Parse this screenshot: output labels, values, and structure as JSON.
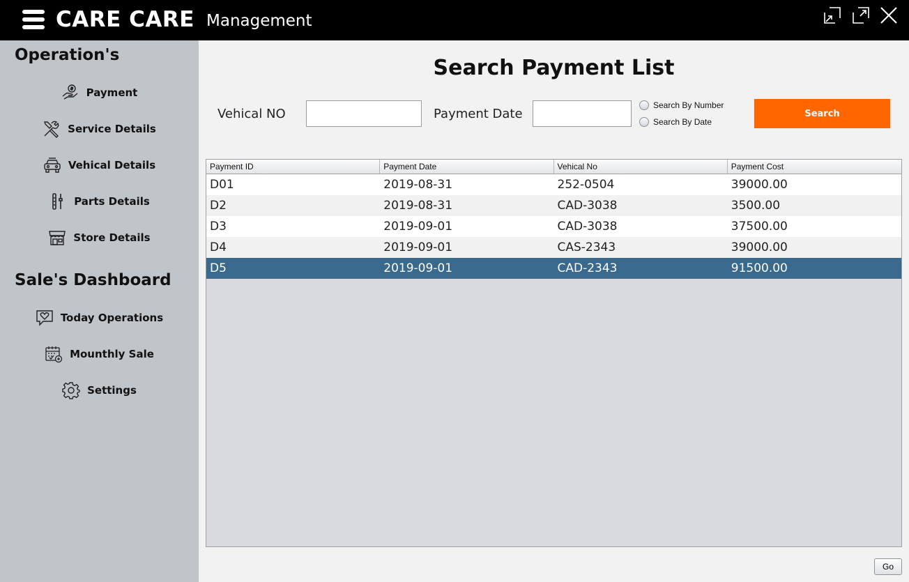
{
  "header": {
    "brand": "CARE CARE",
    "subtitle": "Management"
  },
  "sidebar": {
    "operations_title": "Operation's",
    "operations": [
      {
        "label": "Payment",
        "icon": "payment-hand-icon"
      },
      {
        "label": "Service Details",
        "icon": "tools-icon"
      },
      {
        "label": "Vehical Details",
        "icon": "car-icon"
      },
      {
        "label": "Parts Details",
        "icon": "parts-icon"
      },
      {
        "label": "Store Details",
        "icon": "store-icon"
      }
    ],
    "dashboard_title": "Sale's Dashboard",
    "dashboard": [
      {
        "label": "Today Operations",
        "icon": "chat-heart-icon"
      },
      {
        "label": "Mounthly Sale",
        "icon": "calendar-icon"
      },
      {
        "label": "Settings",
        "icon": "gear-icon"
      }
    ]
  },
  "main": {
    "title": "Search Payment List",
    "vehicle_label": "Vehical NO",
    "vehicle_value": "",
    "date_label": "Payment Date",
    "date_value": "",
    "radio_number": "Search By Number",
    "radio_date": "Search By Date",
    "search_button": "Search",
    "go_button": "Go",
    "accent_color": "#ff6600",
    "selected_row_color": "#39698c"
  },
  "table": {
    "columns": [
      "Payment ID",
      "Payment Date",
      "Vehical No",
      "Payment Cost"
    ],
    "rows": [
      [
        "D01",
        "2019-08-31",
        "252-0504",
        "39000.00"
      ],
      [
        "D2",
        "2019-08-31",
        "CAD-3038",
        "3500.00"
      ],
      [
        "D3",
        "2019-09-01",
        "CAD-3038",
        "37500.00"
      ],
      [
        "D4",
        "2019-09-01",
        "CAS-2343",
        "39000.00"
      ],
      [
        "D5",
        "2019-09-01",
        "CAD-2343",
        "91500.00"
      ]
    ],
    "selected_row": 4
  }
}
